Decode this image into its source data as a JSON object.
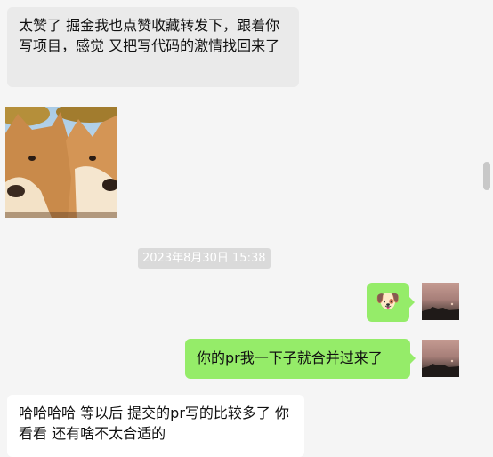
{
  "messages": [
    {
      "sender": "other",
      "text": "太赞了 掘金我也点赞收藏转发下，跟着你写项目，感觉 又把写代码的激情找回来了"
    },
    {
      "sender": "other",
      "type": "image",
      "subject": "shiba-inu-photo"
    },
    {
      "type": "timestamp",
      "text": "2023年8月30日 15:38"
    },
    {
      "sender": "me",
      "type": "emoji",
      "emoji": "🐶"
    },
    {
      "sender": "me",
      "text": "你的pr我一下子就合并过来了"
    },
    {
      "sender": "other",
      "text": "哈哈哈哈 等以后 提交的pr写的比较多了 你看看 还有啥不太合适的"
    }
  ],
  "colors": {
    "background": "#f5f5f5",
    "received_bubble": "#eaeaea",
    "received_bubble_alt": "#ffffff",
    "sent_bubble": "#95ec69",
    "timestamp_bg": "#dadada"
  }
}
